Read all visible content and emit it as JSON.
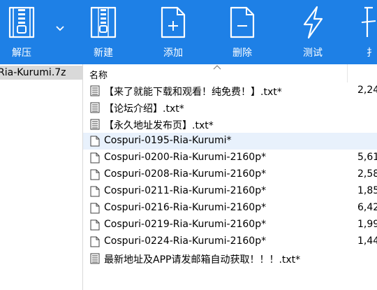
{
  "toolbar": {
    "buttons": [
      {
        "label": "解压",
        "icon": "zip-extract-icon"
      },
      {
        "label": "新建",
        "icon": "zip-new-icon"
      },
      {
        "label": "添加",
        "icon": "add-file-icon"
      },
      {
        "label": "删除",
        "icon": "delete-file-icon"
      },
      {
        "label": "测试",
        "icon": "lightning-test-icon"
      },
      {
        "label": "扌",
        "icon": "info-icon"
      }
    ],
    "background": "#1e80e6"
  },
  "tree": {
    "archive_label": "-Ria-Kurumi.7z"
  },
  "list": {
    "column_name": "名称",
    "rows": [
      {
        "name": "【来了就能下载和观看！纯免费！】.txt*",
        "size": "2,24",
        "type": "text"
      },
      {
        "name": "【论坛介绍】.txt*",
        "size": "",
        "type": "text"
      },
      {
        "name": "【永久地址发布页】.txt*",
        "size": "",
        "type": "text"
      },
      {
        "name": "Cospuri-0195-Ria-Kurumi*",
        "size": "",
        "type": "file",
        "selected": true
      },
      {
        "name": "Cospuri-0200-Ria-Kurumi-2160p*",
        "size": "5,61",
        "type": "file"
      },
      {
        "name": "Cospuri-0208-Ria-Kurumi-2160p*",
        "size": "2,58",
        "type": "file"
      },
      {
        "name": "Cospuri-0211-Ria-Kurumi-2160p*",
        "size": "1,85",
        "type": "file"
      },
      {
        "name": "Cospuri-0216-Ria-Kurumi-2160p*",
        "size": "6,42",
        "type": "file"
      },
      {
        "name": "Cospuri-0219-Ria-Kurumi-2160p*",
        "size": "1,99",
        "type": "file"
      },
      {
        "name": "Cospuri-0224-Ria-Kurumi-2160p*",
        "size": "1,44",
        "type": "file"
      },
      {
        "name": "最新地址及APP请发邮箱自动获取！！！.txt*",
        "size": "",
        "type": "text"
      }
    ]
  }
}
